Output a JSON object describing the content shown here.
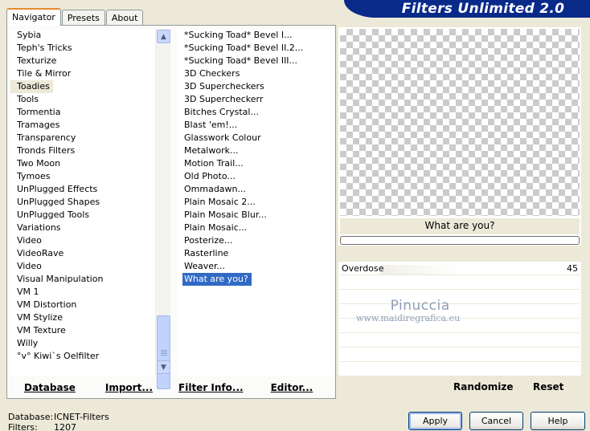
{
  "title": "Filters Unlimited 2.0",
  "tabs": [
    "Navigator",
    "Presets",
    "About"
  ],
  "categories": [
    "Sybia",
    "Teph's Tricks",
    "Texturize",
    "Tile & Mirror",
    "Toadies",
    "Tools",
    "Tormentia",
    "Tramages",
    "Transparency",
    "Tronds Filters",
    "Two Moon",
    "Tymoes",
    "UnPlugged Effects",
    "UnPlugged Shapes",
    "UnPlugged Tools",
    "Variations",
    "Video",
    "VideoRave",
    "Video",
    "Visual Manipulation",
    "VM 1",
    "VM Distortion",
    "VM Stylize",
    "VM Texture",
    "Willy",
    "°v° Kiwi`s Oelfilter"
  ],
  "selected_category": "Toadies",
  "filters": [
    "*Sucking Toad*  Bevel I...",
    "*Sucking Toad*  Bevel II.2...",
    "*Sucking Toad*  Bevel III...",
    "3D Checkers",
    "3D Supercheckers",
    "3D Supercheckerr",
    "Bitches Crystal...",
    "Blast 'em!...",
    "Glasswork Colour",
    "Metalwork...",
    "Motion Trail...",
    "Old Photo...",
    "Ommadawn...",
    "Plain Mosaic 2...",
    "Plain Mosaic Blur...",
    "Plain Mosaic...",
    "Posterize...",
    "Rasterline",
    "Weaver...",
    "What are you?"
  ],
  "selected_filter": "What are you?",
  "left_buttons": {
    "database": "Database",
    "import": "Import...",
    "filter_info": "Filter Info...",
    "editor": "Editor..."
  },
  "current_filter_name": "What are you?",
  "parameters": [
    {
      "label": "Overdose",
      "value": "45"
    }
  ],
  "watermark": {
    "main": "Pinuccia",
    "sub": "www.maidiregrafica.eu"
  },
  "right_buttons": {
    "randomize": "Randomize",
    "reset": "Reset"
  },
  "status": {
    "database_label": "Database:",
    "database_value": "ICNET-Filters",
    "filters_label": "Filters:",
    "filters_value": "1207"
  },
  "dialog_buttons": {
    "apply": "Apply",
    "cancel": "Cancel",
    "help": "Help"
  },
  "colors": {
    "title_bg": "#0a2a8a",
    "selection": "#316ac5",
    "window_bg": "#ece9d8"
  }
}
